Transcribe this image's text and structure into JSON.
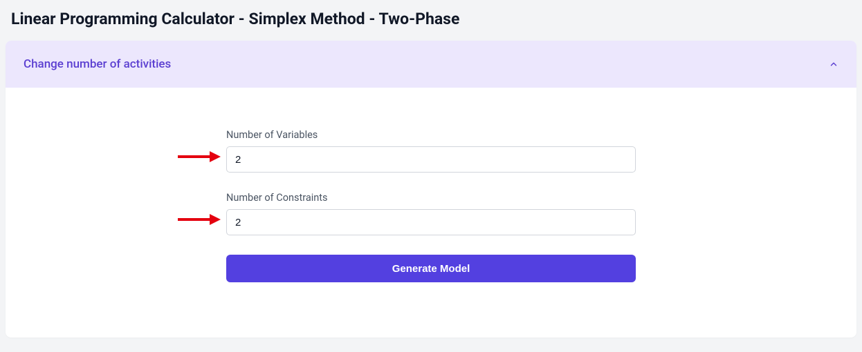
{
  "page": {
    "title": "Linear Programming Calculator - Simplex Method - Two-Phase"
  },
  "accordion": {
    "title": "Change number of activities",
    "expanded": true
  },
  "form": {
    "variables": {
      "label": "Number of Variables",
      "value": "2"
    },
    "constraints": {
      "label": "Number of Constraints",
      "value": "2"
    },
    "submit_label": "Generate Model"
  },
  "colors": {
    "accent": "#5340e0",
    "accordion_bg": "#ece7fd",
    "accordion_text": "#5b3fd1",
    "annotation_arrow": "#e4000f"
  }
}
